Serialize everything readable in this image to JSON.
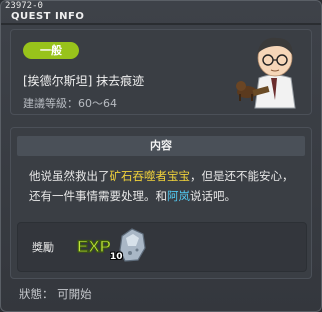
{
  "window": {
    "quest_id": "23972-0",
    "title": "QUEST INFO"
  },
  "quest": {
    "badge": "一般",
    "name": "[挨德尔斯坦] 抹去痕迹",
    "level_range": "建議等級：60～64"
  },
  "content": {
    "header": "内容",
    "desc": {
      "part1": "他说虽然救出了",
      "highlight1": "矿石吞噬者宝宝",
      "part2": "，但是还不能安心，还有一件事情需要处理。和",
      "highlight2": "阿岚",
      "part3": "说话吧。"
    },
    "reward_label": "獎勵",
    "exp_label": "EXP",
    "item_icon": "ore-stone-icon",
    "item_count": "10"
  },
  "status": "狀態： 可開始",
  "colors": {
    "badge": "#98c31b",
    "highlight_yellow": "#f1d23a",
    "highlight_cyan": "#52c8f0"
  }
}
